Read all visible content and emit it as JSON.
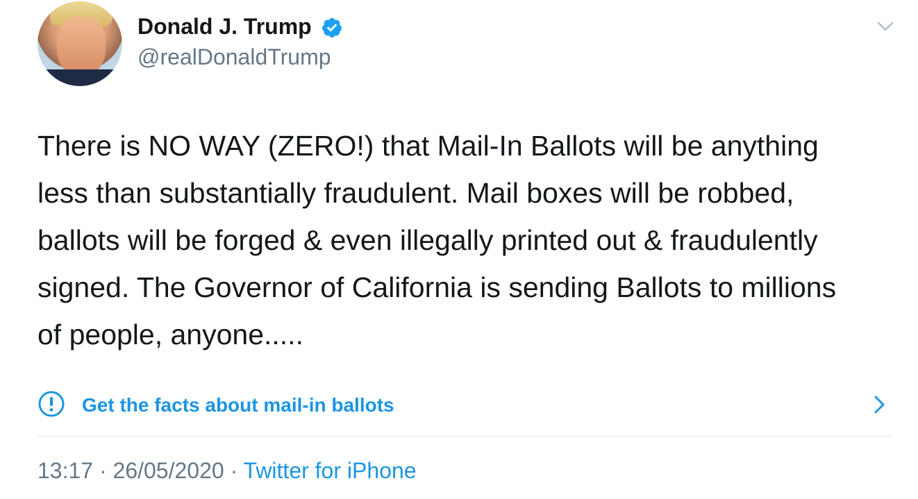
{
  "tweet": {
    "author": {
      "name": "Donald J. Trump",
      "handle": "@realDonaldTrump",
      "verified": true,
      "avatar_icon": "profile-photo"
    },
    "text": "There is NO WAY (ZERO!) that Mail-In Ballots will be anything\nless than substantially fraudulent. Mail boxes will be robbed,\nballots will be forged & even illegally printed out & fraudulently\nsigned. The Governor of California is sending Ballots to millions\nof people, anyone.....",
    "fact_check": {
      "label": "Get the facts about mail-in ballots",
      "icon": "info-circle-icon"
    },
    "meta": {
      "time": "13:17",
      "separator": "·",
      "date": "26/05/2020",
      "source": "Twitter for iPhone"
    }
  },
  "colors": {
    "link_blue": "#1b95e0",
    "text_primary": "#14171a",
    "text_secondary": "#657786",
    "divider": "#e1e8ed"
  }
}
